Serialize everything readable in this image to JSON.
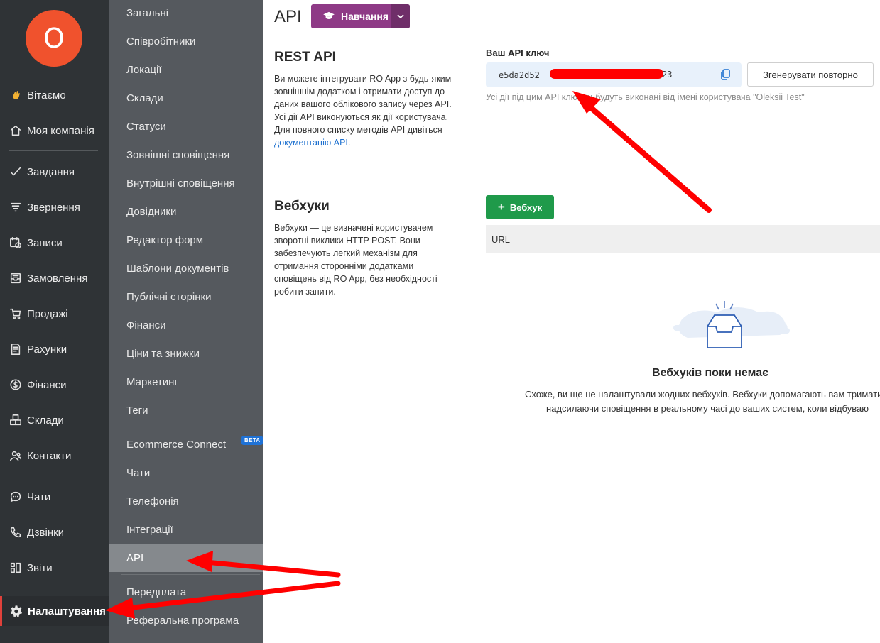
{
  "nav": {
    "avatar_letter": "O",
    "items": [
      {
        "label": "Вітаємо",
        "icon": "wave-hand-icon"
      },
      {
        "label": "Моя компанія",
        "icon": "home-icon"
      },
      {
        "label": "Завдання",
        "icon": "checkmark-icon"
      },
      {
        "label": "Звернення",
        "icon": "funnel-icon"
      },
      {
        "label": "Записи",
        "icon": "calendar-clock-icon"
      },
      {
        "label": "Замовлення",
        "icon": "inbox-tray-icon"
      },
      {
        "label": "Продажі",
        "icon": "cart-icon"
      },
      {
        "label": "Рахунки",
        "icon": "invoice-icon"
      },
      {
        "label": "Фінанси",
        "icon": "dollar-circle-icon"
      },
      {
        "label": "Склади",
        "icon": "boxes-icon"
      },
      {
        "label": "Контакти",
        "icon": "contacts-icon"
      },
      {
        "label": "Чати",
        "icon": "chat-icon"
      },
      {
        "label": "Дзвінки",
        "icon": "phone-icon"
      },
      {
        "label": "Звіти",
        "icon": "reports-icon"
      },
      {
        "label": "Налаштування",
        "icon": "gear-icon"
      }
    ]
  },
  "submenu": {
    "items": [
      "Загальні",
      "Співробітники",
      "Локації",
      "Склади",
      "Статуси",
      "Зовнішні сповіщення",
      "Внутрішні сповіщення",
      "Довідники",
      "Редактор форм",
      "Шаблони документів",
      "Публічні сторінки",
      "Фінанси",
      "Ціни та знижки",
      "Маркетинг",
      "Теги",
      "Ecommerce Connect",
      "Чати",
      "Телефонія",
      "Інтеграції",
      "API",
      "Передплата",
      "Реферальна програма"
    ],
    "beta_badge": "BETA",
    "active": "API"
  },
  "header": {
    "title": "API",
    "learn_button": "Навчання"
  },
  "rest_api": {
    "title": "REST API",
    "description_lines": [
      "Ви можете інтегрувати RO App з будь-яким",
      "зовнішнім додатком і отримати доступ до",
      "даних вашого облікового запису через API.",
      "Усі дії API виконуються як дії користувача.",
      "Для повного списку методів API дивіться"
    ],
    "doc_link": "документацію API",
    "doc_link_suffix": ".",
    "key_label": "Ваш API ключ",
    "key_prefix": "e5da2d52",
    "key_suffix": "23",
    "regenerate_button": "Згенерувати повторно",
    "key_note": "Усі дії під цим API ключем будуть виконані від імені користувача \"Oleksii Test\""
  },
  "webhooks": {
    "title": "Вебхуки",
    "description_lines": [
      "Вебхуки — це визначені користувачем",
      "зворотні виклики HTTP POST. Вони",
      "забезпечують легкий механізм для",
      "отримання сторонніми додатками",
      "сповіщень від RO App, без необхідності",
      "робити запити."
    ],
    "add_button": "Вебхук",
    "table_header": "URL",
    "empty_title": "Вебхуків поки немає",
    "empty_lines": [
      "Схоже, ви ще не налаштували жодних вебхуків. Вебхуки допомагають вам тримати в",
      "надсилаючи сповіщення в реальному часі до ваших систем, коли відбуваю"
    ]
  },
  "colors": {
    "nav_bg": "#2f3336",
    "submenu_bg": "#55595e",
    "avatar": "#f0522d",
    "learn_button": "#8e3a86",
    "add_button": "#1f9a4a",
    "link": "#1b6fcf",
    "annotation_arrow": "#ff0000"
  }
}
